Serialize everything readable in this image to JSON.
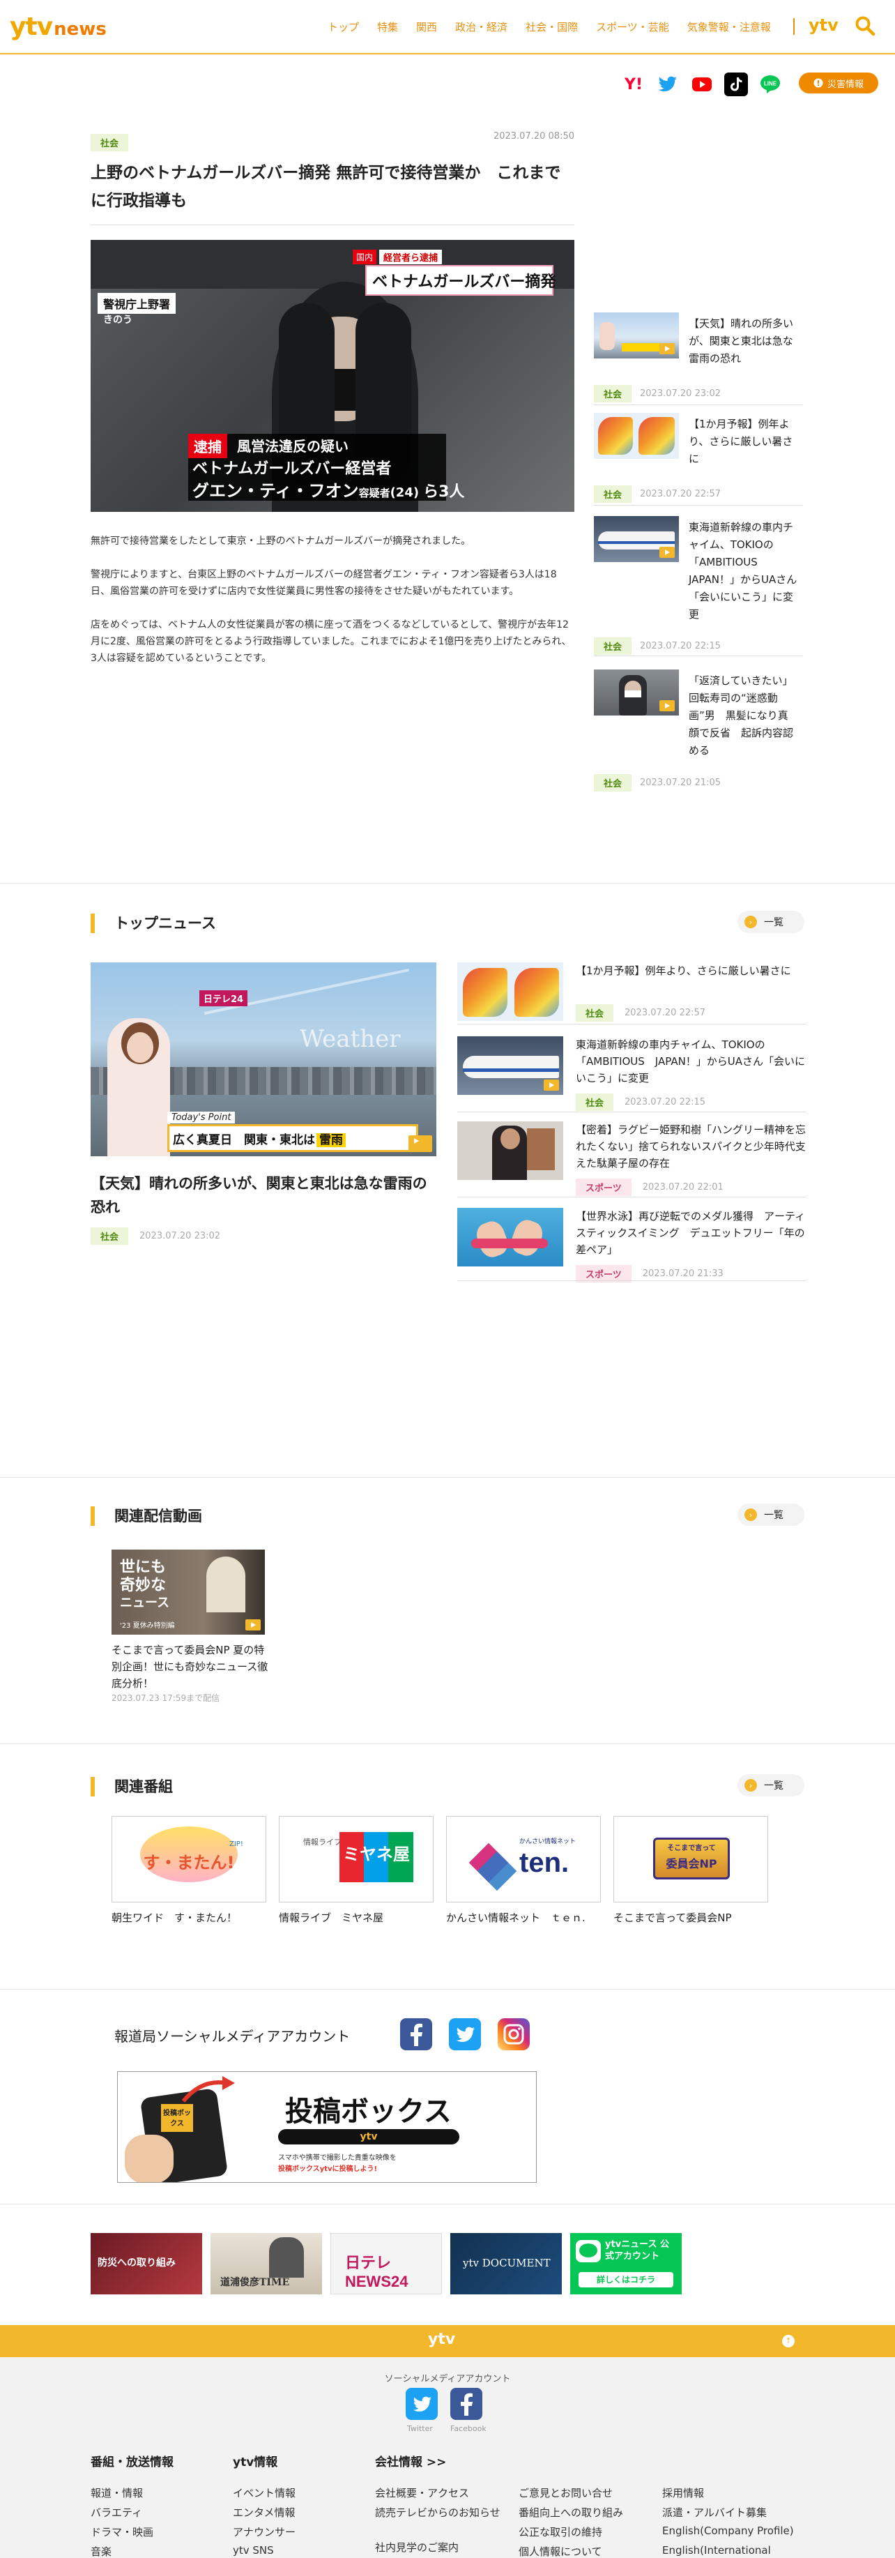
{
  "header": {
    "logo_ytv": "ytv",
    "logo_news": "news",
    "nav": [
      "トップ",
      "特集",
      "関西",
      "政治・経済",
      "社会・国際",
      "スポーツ・芸能",
      "気象警報・注意報"
    ],
    "nav_ytv": "ytv",
    "disaster_label": "災害情報"
  },
  "article": {
    "category": "社会",
    "date": "2023.07.20 08:50",
    "title": "上野のベトナムガールズバー摘発 無許可で接待営業か　これまでに行政指導も",
    "photo_caption_corner": "国内",
    "photo_caption_top": "経営者ら逮捕",
    "photo_caption_title": "ベトナムガールズバー摘発",
    "photo_location": "警視庁上野署",
    "photo_time": "きのう",
    "photo_arrest": "逮捕",
    "photo_line1": "風営法違反の疑い",
    "photo_line2": "ベトナムガールズバー経営者",
    "photo_line3": "グエン・ティ・フオン",
    "photo_line3_suffix": "容疑者",
    "photo_line3_age": "(24)",
    "photo_line3_tail": "ら3人",
    "body": [
      "無許可で接待営業をしたとして東京・上野のベトナムガールズバーが摘発されました。",
      "警視庁によりますと、台東区上野のベトナムガールズバーの経営者グエン・ティ・フオン容疑者ら3人は18日、風俗営業の許可を受けずに店内で女性従業員に男性客の接待をさせた疑いがもたれています。",
      "店をめぐっては、ベトナム人の女性従業員が客の横に座って酒をつくるなどしているとして、警視庁が去年12月に2度、風俗営業の許可をとるよう行政指導していました。これまでにおよそ1億円を売り上げたとみられ、3人は容疑を認めているということです。"
    ]
  },
  "sidebar": [
    {
      "title": "【天気】晴れの所多いが、関東と東北は急な雷雨の恐れ",
      "category": "社会",
      "date": "2023.07.20 23:02"
    },
    {
      "title": "【1か月予報】例年より、さらに厳しい暑さに",
      "category": "社会",
      "date": "2023.07.20 22:57"
    },
    {
      "title": "東海道新幹線の車内チャイム、TOKIOの「AMBITIOUS JAPAN！」からUAさん「会いにいこう」に変更",
      "category": "社会",
      "date": "2023.07.20 22:15"
    },
    {
      "title": "「返済していきたい」回転寿司の“迷惑動画”男　黒髪になり真顔で反省　起訴内容認める",
      "category": "社会",
      "date": "2023.07.20 21:05"
    }
  ],
  "top_news": {
    "heading": "トップニュース",
    "all_label": "一覧",
    "main": {
      "title": "【天気】晴れの所多いが、関東と東北は急な雷雨の恐れ",
      "category": "社会",
      "date": "2023.07.20 23:02",
      "img_weather": "Weather",
      "img_point": "Today's Point",
      "img_caption": "広く真夏日　関東・東北は",
      "img_caption_badge": "雷雨",
      "img_logo": "日テレ24"
    },
    "items": [
      {
        "title": "【1か月予報】例年より、さらに厳しい暑さに",
        "category": "社会",
        "date": "2023.07.20 22:57",
        "sport": false
      },
      {
        "title": "東海道新幹線の車内チャイム、TOKIOの「AMBITIOUS　JAPAN！」からUAさん「会いにいこう」に変更",
        "category": "社会",
        "date": "2023.07.20 22:15",
        "sport": false
      },
      {
        "title": "【密着】ラグビー姫野和樹「ハングリー精神を忘れたくない」捨てられないスパイクと少年時代支えた駄菓子屋の存在",
        "category": "スポーツ",
        "date": "2023.07.20 22:01",
        "sport": true
      },
      {
        "title": "【世界水泳】再び逆転でのメダル獲得　アーティスティックスイミング　デュエットフリー「年の差ペア」",
        "category": "スポーツ",
        "date": "2023.07.20 21:33",
        "sport": true
      }
    ]
  },
  "videos": {
    "heading": "関連配信動画",
    "all_label": "一覧",
    "item": {
      "title": "そこまで言って委員会NP 夏の特別企画！世にも奇妙なニュース徹底分析！",
      "date": "2023.07.23 17:59まで配信",
      "thumb_text1": "世にも",
      "thumb_text2": "奇妙な",
      "thumb_text3": "ニュース",
      "thumb_text4": "'23 夏休み特別編"
    }
  },
  "programs": {
    "heading": "関連番組",
    "all_label": "一覧",
    "items": [
      {
        "label": "朝生ワイド　す・またん！",
        "logo": "す・またん!",
        "logo_sub": "ZIP!"
      },
      {
        "label": "情報ライブ　ミヤネ屋",
        "logo": "ミヤネ屋",
        "logo_sub": "情報ライブ"
      },
      {
        "label": "かんさい情報ネット　ｔｅｎ.",
        "logo": "ten.",
        "logo_sub": "かんさい情報ネット"
      },
      {
        "label": "そこまで言って委員会NP",
        "logo": "委員会NP",
        "logo_sub": "そこまで言って"
      }
    ]
  },
  "social_accounts": {
    "label": "報道局ソーシャルメディアアカウント"
  },
  "toko": {
    "title": "投稿ボックス",
    "brand": "ytv",
    "sub": "スマホや携帯で撮影した貴重な映像を",
    "sub2": "投稿ボックスytvに投稿しよう!",
    "phone_label": "投稿ボックス"
  },
  "banners": [
    {
      "label": "防災への取り組み"
    },
    {
      "label": "道浦俊彦TIME"
    },
    {
      "label": "日テレNEWS24"
    },
    {
      "label": "ytv DOCUMENT"
    },
    {
      "label": "ytvニュース 公式アカウント",
      "sub": "詳しくはコチラ"
    }
  ],
  "footer": {
    "bar_logo": "ytv",
    "social_label": "ソーシャルメディアアカウント",
    "twitter": "Twitter",
    "facebook": "Facebook",
    "col1_head": "番組・放送情報",
    "col1": [
      "報道・情報",
      "バラエティ",
      "ドラマ・映画",
      "音楽"
    ],
    "col2_head": "ytv情報",
    "col2": [
      "イベント情報",
      "エンタメ情報",
      "アナウンサー",
      "ytv SNS"
    ],
    "col3_head": "会社情報 >>",
    "col3a": [
      "会社概要・アクセス",
      "読売テレビからのお知らせ",
      "社内見学のご案内"
    ],
    "col3b": [
      "ご意見とお問い合せ",
      "番組向上への取り組み",
      "公正な取引の維持",
      "個人情報について"
    ],
    "col4": [
      "採用情報",
      "派遣・アルバイト募集",
      "English(Company Profile)",
      "English(International"
    ]
  },
  "colors": {
    "brand": "#f3b72c",
    "accent": "#ef8a00",
    "social_tag_bg": "#edf5d8",
    "sport_tag_bg": "#fbe6ec"
  }
}
